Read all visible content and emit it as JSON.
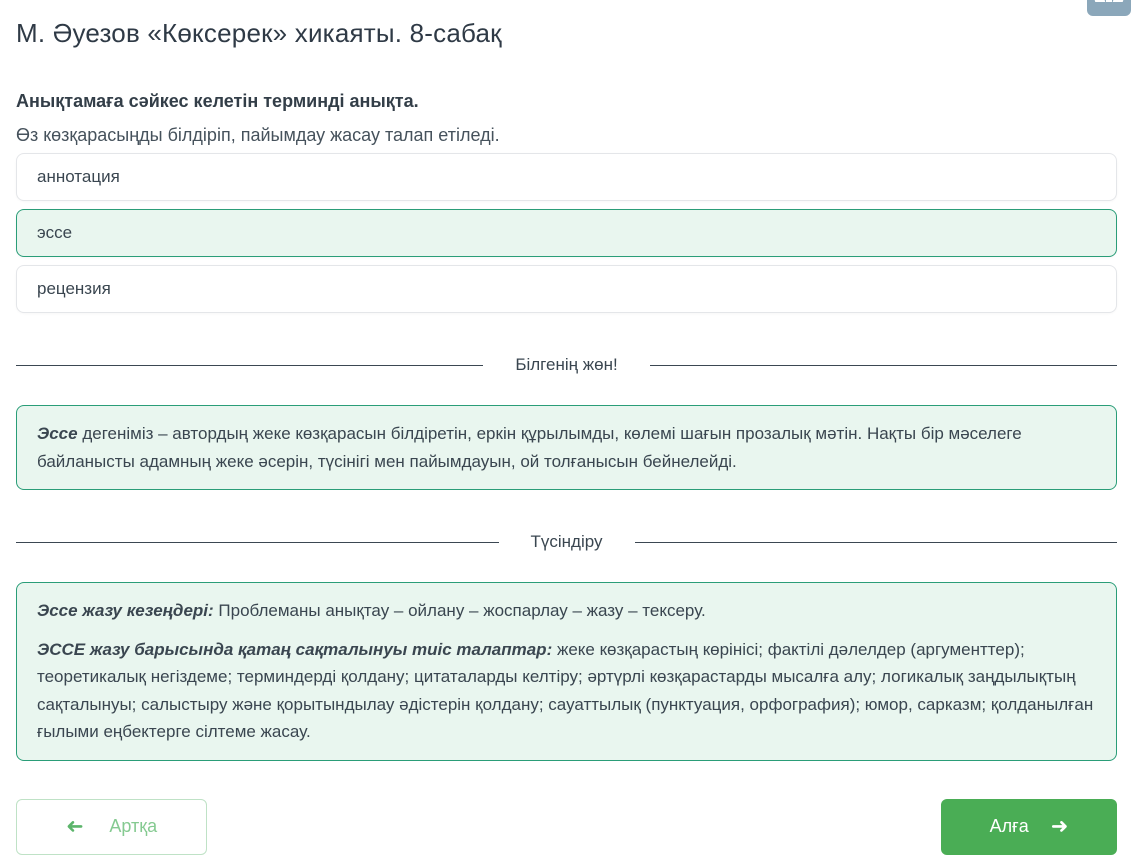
{
  "page": {
    "title": "М. Әуезов «Көксерек» хикаяты. 8-сабақ"
  },
  "question": {
    "prompt": "Анықтамаға сәйкес келетін терминді анықта.",
    "definition": "Өз көзқарасыңды білдіріп, пайымдау жасау талап етіледі.",
    "options": [
      {
        "label": "аннотация",
        "selected": false
      },
      {
        "label": "эссе",
        "selected": true
      },
      {
        "label": "рецензия",
        "selected": false
      }
    ]
  },
  "know_section": {
    "divider_label": "Білгенің жөн!",
    "lead_bold": "Эссе",
    "text": " дегеніміз – автордың жеке көзқарасын білдіретін, еркін құрылымды, көлемі шағын прозалық мәтін. Нақты бір мәселеге байланысты адамның жеке әсерін, түсінігі мен пайымдауын, ой толғанысын бейнелейді."
  },
  "explain_section": {
    "divider_label": "Түсіндіру",
    "p1_bold": "Эссе жазу кезеңдері:",
    "p1_text": " Проблеманы анықтау – ойлану – жоспарлау – жазу – тексеру.",
    "p2_bold": "ЭССЕ жазу барысында қатаң сақталынуы тиіс талаптар:",
    "p2_text": " жеке көзқарастың көрінісі; фактілі дәлелдер (аргументтер); теоретикалық негіздеме; терминдерді қолдану; цитаталарды келтіру; әртүрлі көзқарастарды мысалға алу; логикалық заңдылықтың сақталынуы; салыстыру және қорытындылау әдістерін қолдану; сауаттылық (пунктуация, орфография); юмор, сарказм; қолданылған ғылыми еңбектерге сілтеме жасау."
  },
  "footer": {
    "back_label": "Артқа",
    "next_label": "Алға",
    "back_arrow": "➜",
    "next_arrow": "➜"
  },
  "colors": {
    "accent_green": "#4aad55",
    "selected_border": "#2a9d78",
    "selected_background": "#e9f6ef",
    "back_button_text": "#85ca91",
    "corner_icon_blue": "#8ba7ba"
  }
}
